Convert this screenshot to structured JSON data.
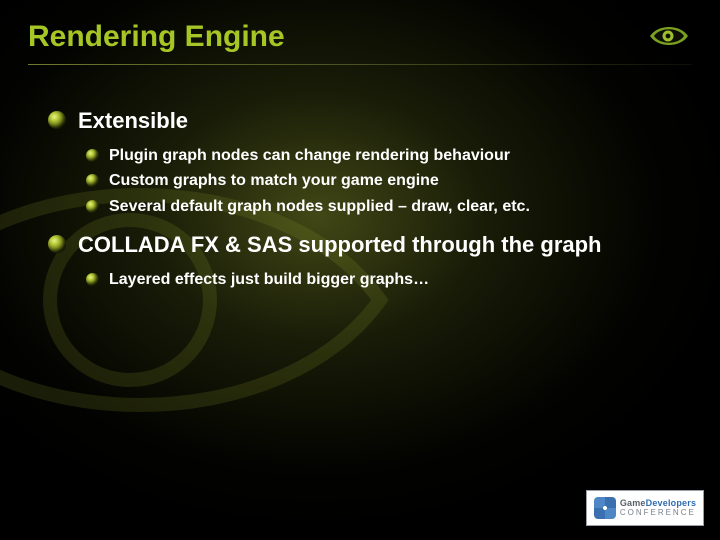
{
  "title": "Rendering Engine",
  "logo_tr": "nvidia-eye-icon",
  "bullets": [
    {
      "label": "Extensible",
      "children": [
        "Plugin graph nodes can change rendering behaviour",
        "Custom graphs to match your game engine",
        "Several default graph nodes supplied – draw, clear, etc."
      ]
    },
    {
      "label": "COLLADA FX & SAS supported through the graph",
      "children": [
        "Layered effects just build bigger graphs…"
      ]
    }
  ],
  "footer_logo": {
    "line1_a": "Game",
    "line1_b": "Developers",
    "line2": "CONFERENCE"
  }
}
